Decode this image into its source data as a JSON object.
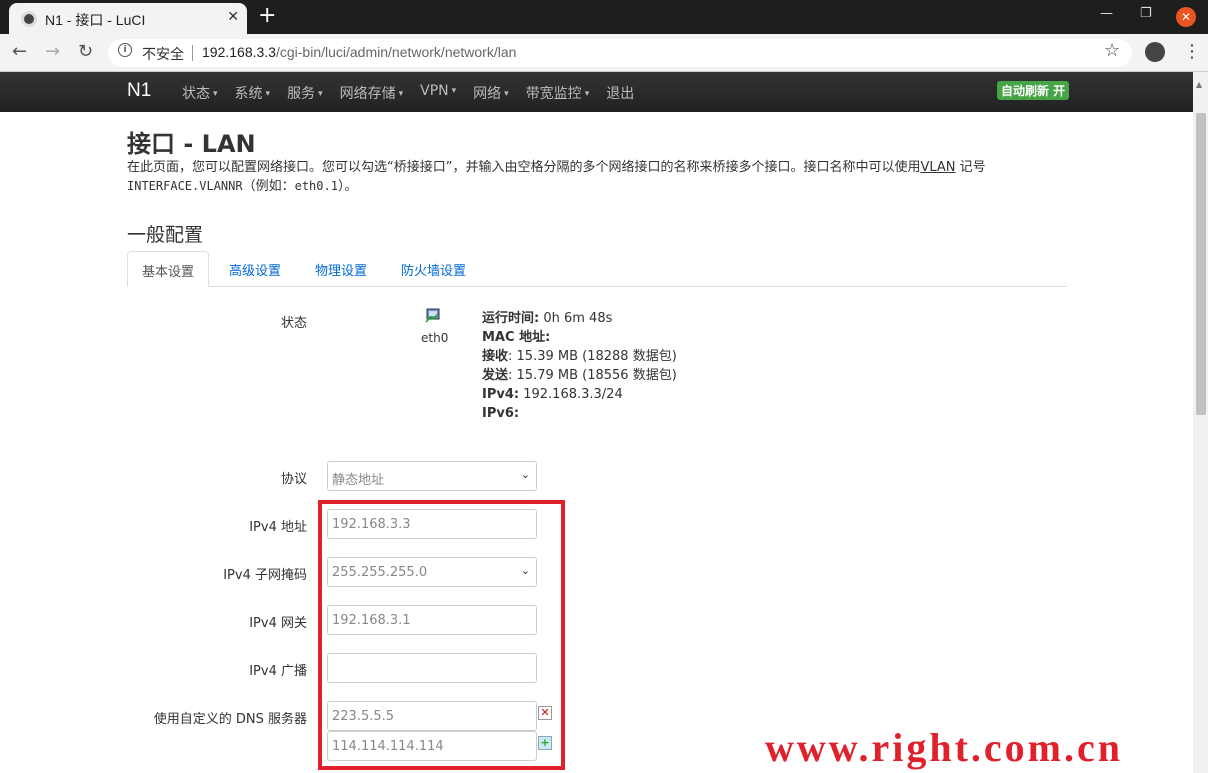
{
  "browser": {
    "tab_title": "N1 - 接口 - LuCI",
    "tab_close": "✕",
    "new_tab": "+",
    "insecure_label": "不安全",
    "url_host": "192.168.3.3",
    "url_path": "/cgi-bin/luci/admin/network/network/lan"
  },
  "navbar": {
    "brand": "N1",
    "menu": [
      "状态",
      "系统",
      "服务",
      "网络存储",
      "VPN",
      "网络",
      "带宽监控",
      "退出"
    ],
    "menu_caret": "▾",
    "autorefresh": "自动刷新 开"
  },
  "page": {
    "title": "接口 - LAN",
    "desc_part1": "在此页面，您可以配置网络接口。您可以勾选“桥接接口”，并输入由空格分隔的多个网络接口的名称来桥接多个接口。接口名称中可以使用",
    "desc_vlan": "VLAN",
    "desc_part2": " 记号",
    "desc_mono": "INTERFACE.VLANNR",
    "desc_part3": "（例如：",
    "desc_example": "eth0.1",
    "desc_part4": "）。",
    "section_title": "一般配置",
    "tabs": [
      "基本设置",
      "高级设置",
      "物理设置",
      "防火墙设置"
    ]
  },
  "status": {
    "label": "状态",
    "device": "eth0",
    "uptime_label": "运行时间:",
    "uptime_value": " 0h 6m 48s",
    "mac_label": "MAC 地址:",
    "rx_label": "接收",
    "rx_value": ": 15.39 MB (18288 数据包)",
    "tx_label": "发送",
    "tx_value": ": 15.79 MB (18556 数据包)",
    "ipv4_label": "IPv4:",
    "ipv4_value": " 192.168.3.3/24",
    "ipv6_label": "IPv6:"
  },
  "form": {
    "protocol_label": "协议",
    "protocol_value": "静态地址",
    "ipv4_addr_label": "IPv4 地址",
    "ipv4_addr_value": "192.168.3.3",
    "netmask_label": "IPv4 子网掩码",
    "netmask_value": "255.255.255.0",
    "gateway_label": "IPv4 网关",
    "gateway_value": "192.168.3.1",
    "broadcast_label": "IPv4 广播",
    "broadcast_value": "",
    "dns_label": "使用自定义的 DNS 服务器",
    "dns_values": [
      "223.5.5.5",
      "114.114.114.114"
    ]
  },
  "watermark": "www.right.com.cn",
  "colors": {
    "highlight_border": "#e0202a",
    "autorefresh_bg": "#46a546",
    "link": "#0069d6"
  }
}
